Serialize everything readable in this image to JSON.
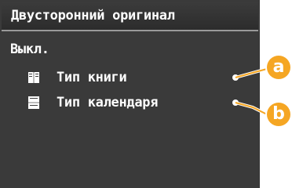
{
  "header": {
    "title": "Двусторонний оригинал"
  },
  "current_setting": "Выкл.",
  "menu": {
    "items": [
      {
        "label": "Тип книги",
        "icon": "book-type-icon"
      },
      {
        "label": "Тип календаря",
        "icon": "calendar-type-icon"
      }
    ]
  },
  "callouts": [
    "a",
    "b"
  ],
  "colors": {
    "screen_bg": "#3a3a3a",
    "title_underline": "#9a9a9a",
    "text": "#ffffff",
    "callout_orange": "#f5a623"
  }
}
